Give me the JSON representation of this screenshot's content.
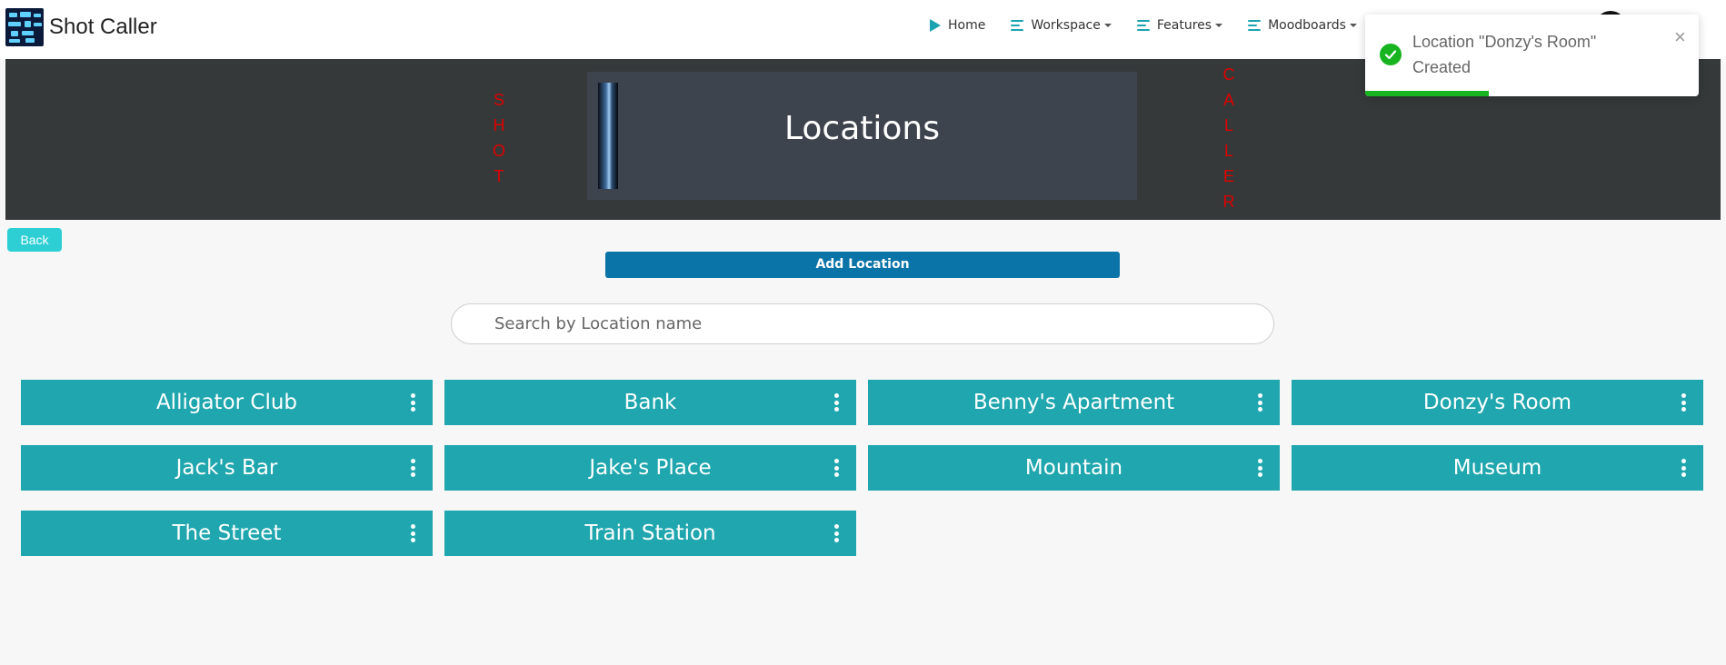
{
  "app": {
    "title": "Shot Caller"
  },
  "nav": {
    "home": "Home",
    "workspace": "Workspace",
    "features": "Features",
    "moodboards": "Moodboards"
  },
  "banner": {
    "title": "Locations",
    "left_letters": [
      "S",
      "H",
      "O",
      "T"
    ],
    "right_letters": [
      "C",
      "A",
      "L",
      "L",
      "E",
      "R"
    ]
  },
  "actions": {
    "back": "Back",
    "add_location": "Add Location"
  },
  "search": {
    "placeholder": "Search by Location name",
    "value": ""
  },
  "locations": [
    "Alligator Club",
    "Bank",
    "Benny's Apartment",
    "Donzy's Room",
    "Jack's Bar",
    "Jake's Place",
    "Mountain",
    "Museum",
    "The Street",
    "Train Station"
  ],
  "toast": {
    "message_line1": "Location \"Donzy's Room\"",
    "message_line2": "Created",
    "close": "×",
    "progress": 0.37
  },
  "colors": {
    "accent": "#1fa6ae",
    "primary_button": "#0a73a8",
    "back_button": "#2ecfd4",
    "banner_bg": "#353939",
    "banner_letters": "#e00000",
    "success": "#17b41f"
  }
}
